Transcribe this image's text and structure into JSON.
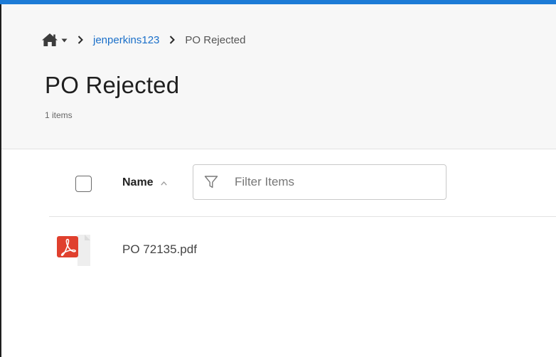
{
  "breadcrumb": {
    "home_icon": "home-icon",
    "dropdown_icon": "caret-down-icon",
    "separator_icon": "chevron-right-icon",
    "items": [
      {
        "label": "jenperkins123",
        "link": true
      },
      {
        "label": "PO Rejected",
        "link": false
      }
    ]
  },
  "header": {
    "title": "PO Rejected",
    "item_count": "1 items"
  },
  "toolbar": {
    "select_all_checked": false,
    "sort_label": "Name",
    "sort_direction": "ascending",
    "sort_icon": "caret-up-icon",
    "filter_icon": "funnel-icon",
    "filter_placeholder": "Filter Items",
    "filter_value": ""
  },
  "files": [
    {
      "name": "PO 72135.pdf",
      "type": "pdf",
      "icon": "pdf-file-icon"
    }
  ],
  "colors": {
    "accent": "#1d7bd6",
    "link": "#1a6fc9",
    "pdf_red": "#e0402e",
    "header_bg": "#f7f7f7"
  }
}
